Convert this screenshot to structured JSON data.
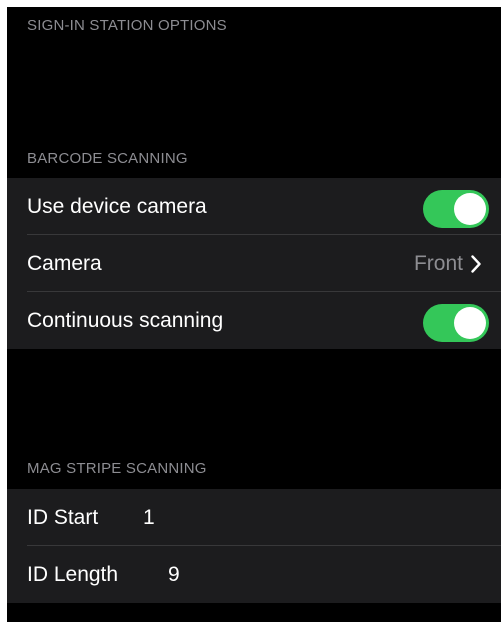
{
  "header": {
    "title": "SIGN-IN STATION OPTIONS"
  },
  "barcode": {
    "header": "BARCODE SCANNING",
    "use_camera_label": "Use device camera",
    "use_camera_on": true,
    "camera_label": "Camera",
    "camera_value": "Front",
    "continuous_label": "Continuous scanning",
    "continuous_on": true
  },
  "magstripe": {
    "header": "MAG STRIPE SCANNING",
    "id_start_label": "ID Start",
    "id_start_value": "1",
    "id_length_label": "ID Length",
    "id_length_value": "9"
  },
  "colors": {
    "toggle_on": "#34c759",
    "background": "#000000",
    "group_background": "#1c1c1e",
    "secondary_text": "#8d8d92"
  },
  "icons": {
    "chevron": "chevron-right-icon"
  }
}
